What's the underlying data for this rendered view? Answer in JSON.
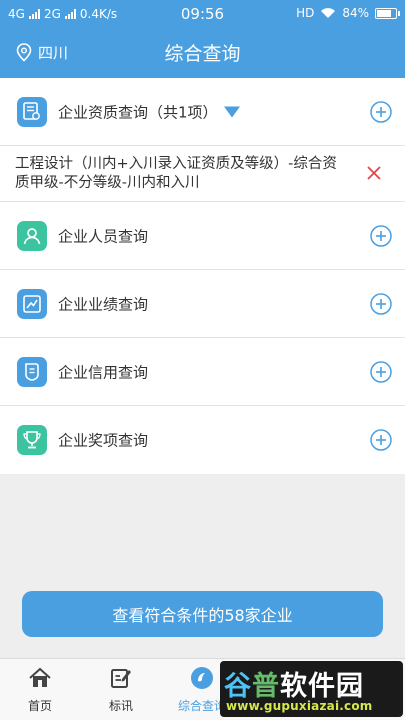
{
  "status_bar": {
    "signal_1": "4G",
    "signal_2": "2G",
    "speed": "0.4K/s",
    "time": "09:56",
    "hd": "HD",
    "battery": "84%",
    "battery_level": 0.84
  },
  "header": {
    "location": "四川",
    "title": "综合查询"
  },
  "rows": [
    {
      "label": "企业资质查询（共1项）",
      "icon": "certificate-icon",
      "color": "#4a9fe0"
    },
    {
      "label": "企业人员查询",
      "icon": "person-icon",
      "color": "#3cc3a0"
    },
    {
      "label": "企业业绩查询",
      "icon": "trend-chart-icon",
      "color": "#4a9fe0"
    },
    {
      "label": "企业信用查询",
      "icon": "credit-shield-icon",
      "color": "#4a9fe0"
    },
    {
      "label": "企业奖项查询",
      "icon": "trophy-icon",
      "color": "#3cc3a0"
    }
  ],
  "detail": {
    "text": "工程设计（川内+入川录入证资质及等级）-综合资质甲级-不分等级-川内和入川"
  },
  "cta": {
    "label": "查看符合条件的58家企业"
  },
  "tabs": [
    {
      "label": "首页"
    },
    {
      "label": "标讯"
    },
    {
      "label": "综合查询"
    }
  ],
  "watermark": {
    "chars": [
      "谷",
      "普",
      "软",
      "件",
      "园"
    ],
    "url": "www.gupuxiazai.com"
  },
  "colors": {
    "accent": "#4a9fe0",
    "teal": "#3cc3a0",
    "remove": "#e04545"
  }
}
